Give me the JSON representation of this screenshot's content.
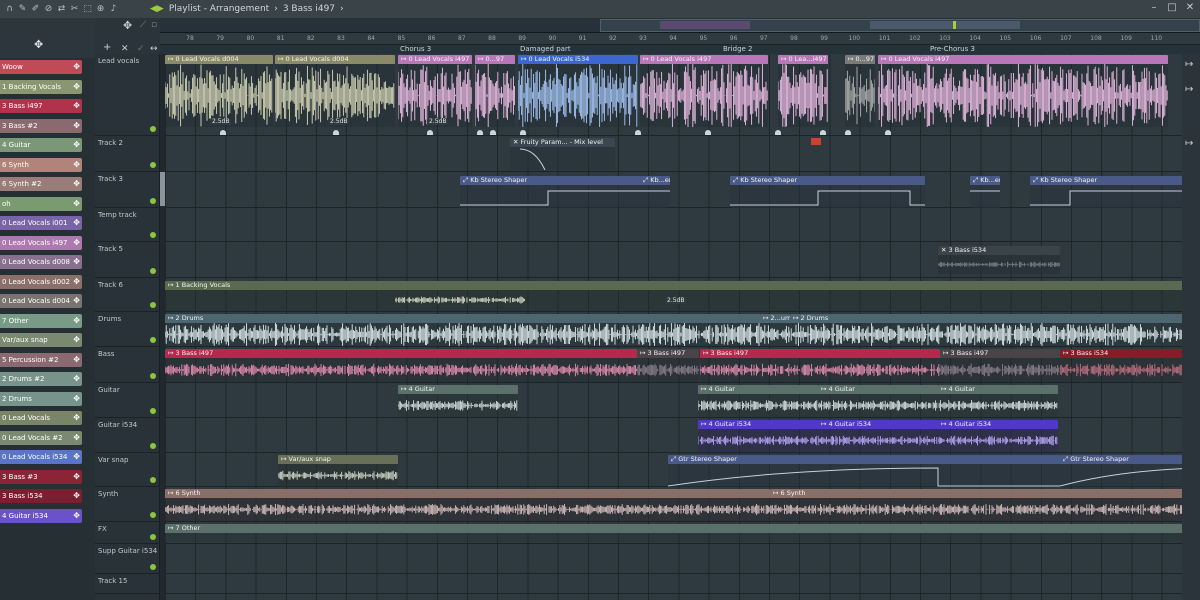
{
  "titlebar": {
    "title": "Playlist - Arrangement",
    "pattern": "3 Bass i497"
  },
  "toolbar_icons": [
    "magnet-icon",
    "pencil-icon",
    "brush-icon",
    "mute-icon",
    "slip-icon",
    "slice-icon",
    "select-icon",
    "zoom-icon",
    "playback-icon"
  ],
  "ruler": {
    "bars": [
      "78",
      "79",
      "80",
      "81",
      "82",
      "83",
      "84",
      "85",
      "86",
      "87",
      "88",
      "89",
      "90",
      "91",
      "92",
      "93",
      "94",
      "95",
      "96",
      "97",
      "98",
      "99",
      "100",
      "101",
      "102",
      "103",
      "104",
      "105",
      "106",
      "107",
      "108",
      "109",
      "110"
    ]
  },
  "markers": [
    {
      "label": "Chorus 3"
    },
    {
      "label": "Damaged part"
    },
    {
      "label": "Bridge 2"
    },
    {
      "label": "Pre-Chorus 3"
    }
  ],
  "picker": [
    {
      "label": "Woow",
      "color": "#c04b57"
    },
    {
      "label": "1 Backing Vocals",
      "color": "#8a9670"
    },
    {
      "label": "3 Bass i497",
      "color": "#b0334c"
    },
    {
      "label": "3 Bass #2",
      "color": "#8a6a70"
    },
    {
      "label": "4 Guitar",
      "color": "#7a9878"
    },
    {
      "label": "6 Synth",
      "color": "#b08478"
    },
    {
      "label": "6 Synth #2",
      "color": "#9a7c78"
    },
    {
      "label": "oh",
      "color": "#7a9a70"
    },
    {
      "label": "0 Lead Vocals i001",
      "color": "#7a64a8"
    },
    {
      "label": "0 Lead Vocals i497",
      "color": "#b078b0"
    },
    {
      "label": "0 Lead Vocals d008",
      "color": "#8a7090"
    },
    {
      "label": "0 Lead Vocals d002",
      "color": "#8a7068"
    },
    {
      "label": "0 Lead Vocals d004",
      "color": "#7a7470"
    },
    {
      "label": "7 Other",
      "color": "#7a9a88"
    },
    {
      "label": "Var/aux snap",
      "color": "#7a8a70"
    },
    {
      "label": "5 Percussion #2",
      "color": "#8a6a70"
    },
    {
      "label": "2 Drums #2",
      "color": "#78948a"
    },
    {
      "label": "2 Drums",
      "color": "#76948a"
    },
    {
      "label": "0 Lead Vocals",
      "color": "#7a8468"
    },
    {
      "label": "0 Lead Vocals #2",
      "color": "#7a8a70"
    },
    {
      "label": "0 Lead Vocals i534",
      "color": "#5a74c8"
    },
    {
      "label": "3 Bass #3",
      "color": "#8a2436"
    },
    {
      "label": "3 Bass i534",
      "color": "#7a1e30"
    },
    {
      "label": "4 Guitar i534",
      "color": "#6a52c8"
    }
  ],
  "tracks": [
    {
      "name": "Lead vocals"
    },
    {
      "name": "Track 2"
    },
    {
      "name": "Track 3"
    },
    {
      "name": "Temp track"
    },
    {
      "name": "Track 5"
    },
    {
      "name": "Track 6"
    },
    {
      "name": "Drums"
    },
    {
      "name": "Bass"
    },
    {
      "name": "Guitar"
    },
    {
      "name": "Guitar i534"
    },
    {
      "name": "Var snap"
    },
    {
      "name": "Synth"
    },
    {
      "name": "FX"
    },
    {
      "name": "Supp Guitar i534"
    },
    {
      "name": "Track 15"
    }
  ],
  "clips": {
    "lead": [
      {
        "label": "0 Lead Vocals d004",
        "color": "#8a8a68",
        "wave": "#d8d8b8"
      },
      {
        "label": "0 Lead Vocals d004",
        "color": "#8a8a68",
        "wave": "#d8d8b8"
      },
      {
        "label": "0 Lead Vocals i497",
        "color": "#b878b8",
        "wave": "#f0c0e8"
      },
      {
        "label": "0...97",
        "color": "#b878b8",
        "wave": "#f0c0e8"
      },
      {
        "label": "0 Lead Vocals i534",
        "color": "#3a68d0",
        "wave": "#a8c8f8"
      },
      {
        "label": "0 Lead Vocals i497",
        "color": "#b878b8",
        "wave": "#f0c0e8"
      },
      {
        "label": "0 Lea...i497",
        "color": "#b878b8",
        "wave": "#f0c0e8"
      },
      {
        "label": "0...97",
        "color": "#7a7a7a",
        "wave": "#b0b0b0"
      },
      {
        "label": "0 Lead Vocals i497",
        "color": "#b878b8",
        "wave": "#f0c0e8"
      }
    ],
    "lead_db": [
      "2.5dB",
      "2.5dB",
      "2.5dB"
    ],
    "track2": {
      "label": "Fruity Param... - Mix level",
      "color": "#34404a"
    },
    "track3": [
      {
        "label": "Kb Stereo Shaper"
      },
      {
        "label": "Kb...er"
      },
      {
        "label": "Kb Stereo Shaper"
      },
      {
        "label": "Kb...er"
      },
      {
        "label": "Kb Stereo Shaper"
      }
    ],
    "track5": {
      "label": "3 Bass i534"
    },
    "track6": {
      "label": "1 Backing Vocals",
      "db": "2.5dB"
    },
    "drums": [
      {
        "label": "2 Drums"
      },
      {
        "label": "2...ums"
      },
      {
        "label": "2 Drums"
      }
    ],
    "bass": [
      {
        "label": "3 Bass i497"
      },
      {
        "label": "3 Bass i497"
      },
      {
        "label": "3 Bass i497"
      },
      {
        "label": "3 Bass i497"
      },
      {
        "label": "3 Bass i534"
      }
    ],
    "guitar": [
      {
        "label": "4 Guitar"
      },
      {
        "label": "4 Guitar"
      },
      {
        "label": "4 Guitar"
      },
      {
        "label": "4 Guitar"
      }
    ],
    "guitar_i534": [
      {
        "label": "4 Guitar i534"
      },
      {
        "label": "4 Guitar i534"
      },
      {
        "label": "4 Guitar i534"
      }
    ],
    "varsnap": [
      {
        "label": "Var/aux snap"
      },
      {
        "label": "Gtr Stereo Shaper"
      },
      {
        "label": "Gtr Stereo Shaper"
      }
    ],
    "synth": [
      {
        "label": "6 Synth"
      },
      {
        "label": "6 Synth"
      }
    ],
    "fx": {
      "label": "7 Other"
    }
  }
}
